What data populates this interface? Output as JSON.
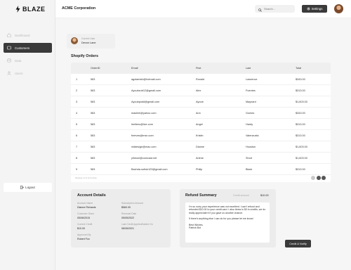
{
  "app": {
    "logo_text": "BLAZE",
    "org_name": "ACME Corporation"
  },
  "sidebar": {
    "items": [
      {
        "label": "Dashboard",
        "icon": "home-icon",
        "active": false
      },
      {
        "label": "Customers",
        "icon": "users-icon",
        "active": true
      },
      {
        "label": "Data",
        "icon": "database-icon",
        "active": false
      },
      {
        "label": "Users",
        "icon": "user-icon",
        "active": false
      }
    ],
    "logout_label": "Logout"
  },
  "header": {
    "search_placeholder": "Search...",
    "settings_label": "Settings"
  },
  "user_card": {
    "label": "Current User",
    "name": "Devon Lane"
  },
  "orders": {
    "title": "Shopify Orders",
    "columns": [
      "",
      "OrderID",
      "Email",
      "First",
      "Last",
      "Total"
    ],
    "rows": [
      [
        "1",
        "583",
        "agolamish@hotmail.com",
        "Ronald",
        "Lawrence",
        "$343.00"
      ],
      [
        "2",
        "583",
        "Ayoubzub12@gmail.com",
        "Alex",
        "Fuentes",
        "$313.00"
      ],
      [
        "3",
        "583",
        "Ayoubpodd@gmail.com",
        "Ayoub",
        "Maynard",
        "$1,603.00"
      ],
      [
        "4",
        "583",
        "maslinh@yahoo.com",
        "Ann",
        "Gomes",
        "$343.00"
      ],
      [
        "5",
        "583",
        "leelleeu@live.com",
        "Angel",
        "Hardy",
        "$313.00"
      ],
      [
        "6",
        "583",
        "freeves@msn.com",
        "Kristin",
        "Valenzuela",
        "$313.00"
      ],
      [
        "7",
        "583",
        "nlddesign@mac.com",
        "Dianne",
        "Houston",
        "$1,603.00"
      ],
      [
        "8",
        "583",
        "yiheunl@comcast.net",
        "Arlene",
        "Short",
        "$1,603.00"
      ],
      [
        "9",
        "583",
        "Bachda.outlok123@gmail.com",
        "Philip",
        "Black",
        "$313.00"
      ]
    ],
    "footer_text": "Showing 1 to 9 of 9 entries"
  },
  "account": {
    "title": "Account Details",
    "fields": [
      {
        "label": "Account Name",
        "value": "Dianne Richards"
      },
      {
        "label": "Subscription Amount",
        "value": "$560.00"
      },
      {
        "label": "Customer Since",
        "value": "05/06/2015"
      },
      {
        "label": "Renewal Date",
        "value": "05/05/2022"
      },
      {
        "label": "Current Credit",
        "value": "$10.00"
      },
      {
        "label": "Last Credit Applied/Added On",
        "value": "08/26/2021"
      },
      {
        "label": "Approved By",
        "value": "Robert Fox"
      }
    ]
  },
  "refund": {
    "title": "Refund Summary",
    "amount_label": "Credit amount",
    "amount_value": "$10.00",
    "message_p1": "I'm so sorry your experience was not excellent. I can't refund and refunded $10.00 to your credit card. I also threw in $3 in credits, we do really appreciate it if you gave us another chance.",
    "message_p2": "If there's anything else I can do for you please let me know!",
    "signature_1": "Best Wishes,",
    "signature_2": "Patrick Bot",
    "action_label": "Credit & Notify"
  }
}
